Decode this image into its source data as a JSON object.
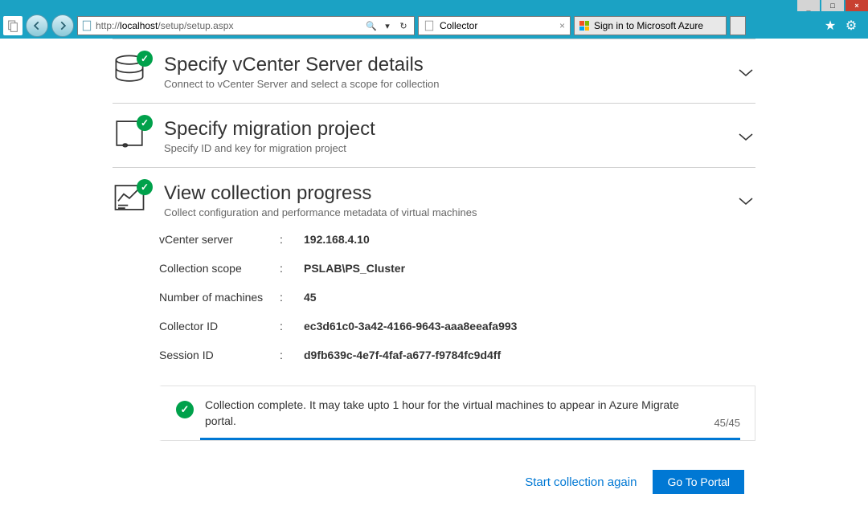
{
  "window": {
    "min_label": "_",
    "max_label": "□",
    "close_label": "×"
  },
  "browser": {
    "url_display": "http://localhost/setup/setup.aspx",
    "url_prefix": "http://",
    "url_host": "localhost",
    "url_path": "/setup/setup.aspx",
    "tab1_label": "Collector",
    "tab2_label": "Sign in to Microsoft Azure"
  },
  "steps": [
    {
      "title": "Specify vCenter Server details",
      "sub": "Connect to vCenter Server and select a scope for collection"
    },
    {
      "title": "Specify migration project",
      "sub": "Specify ID and key for migration project"
    },
    {
      "title": "View collection progress",
      "sub": "Collect configuration and performance metadata of virtual machines"
    }
  ],
  "details": {
    "rows": [
      {
        "label": "vCenter server",
        "value": "192.168.4.10"
      },
      {
        "label": "Collection scope",
        "value": "PSLAB\\PS_Cluster"
      },
      {
        "label": "Number of machines",
        "value": "45"
      },
      {
        "label": "Collector ID",
        "value": "ec3d61c0-3a42-4166-9643-aaa8eeafa993"
      },
      {
        "label": "Session ID",
        "value": "d9fb639c-4e7f-4faf-a677-f9784fc9d4ff"
      }
    ]
  },
  "status": {
    "message": "Collection complete. It may take upto 1 hour for the virtual machines to appear in Azure Migrate portal.",
    "count": "45/45"
  },
  "actions": {
    "again": "Start collection again",
    "portal": "Go To Portal"
  }
}
